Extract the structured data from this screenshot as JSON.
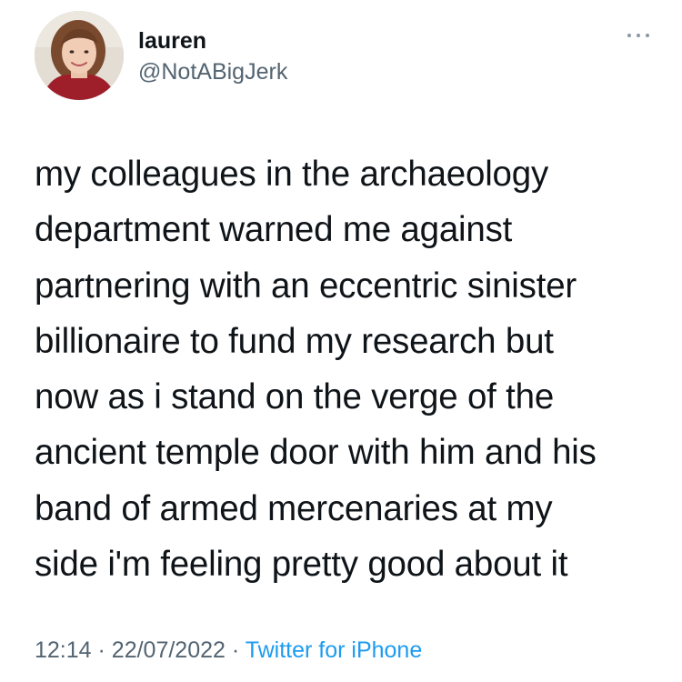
{
  "user": {
    "display_name": "lauren",
    "handle": "@NotABigJerk"
  },
  "tweet": {
    "lines": [
      "my colleagues in the archaeology",
      "department warned me against",
      "partnering with an eccentric sinister",
      "billionaire to fund my research but",
      "now as i stand on the verge of the",
      "ancient temple door with him and his",
      "band of armed mercenaries at my",
      "side i'm feeling pretty good about it"
    ]
  },
  "meta": {
    "time": "12:14",
    "separator": "·",
    "date": "22/07/2022",
    "source": "Twitter for iPhone"
  },
  "icons": {
    "more": "more-options-icon",
    "avatar": "profile-photo"
  },
  "colors": {
    "text": "#0f1419",
    "secondary": "#536471",
    "link": "#1d9bf0"
  }
}
